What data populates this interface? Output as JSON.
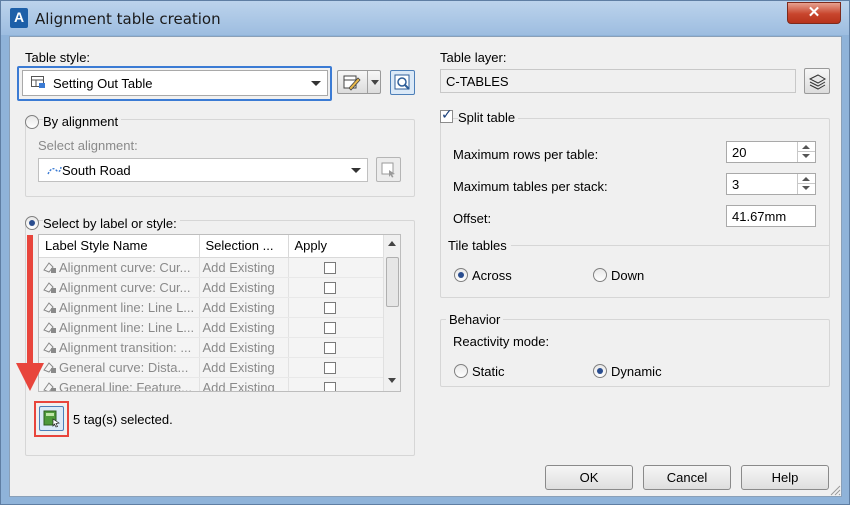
{
  "window": {
    "title": "Alignment table creation",
    "close_glyph": "✕",
    "app_icon_letter": "A"
  },
  "table_style": {
    "label": "Table style:",
    "selected": "Setting Out Table"
  },
  "by_alignment": {
    "label": "By alignment",
    "select_label": "Select alignment:",
    "selected": "South Road",
    "checked": false
  },
  "select_by_label": {
    "label": "Select by label or style:",
    "checked": true,
    "columns": [
      "Label Style Name",
      "Selection ...",
      "Apply"
    ],
    "rows": [
      {
        "name": "Alignment curve: Cur...",
        "selection": "Add Existing",
        "apply": false
      },
      {
        "name": "Alignment curve: Cur...",
        "selection": "Add Existing",
        "apply": false
      },
      {
        "name": "Alignment line: Line L...",
        "selection": "Add Existing",
        "apply": false
      },
      {
        "name": "Alignment line: Line L...",
        "selection": "Add Existing",
        "apply": false
      },
      {
        "name": "Alignment transition: ...",
        "selection": "Add Existing",
        "apply": false
      },
      {
        "name": "General curve: Dista...",
        "selection": "Add Existing",
        "apply": false
      },
      {
        "name": "General line: Feature...",
        "selection": "Add Existing",
        "apply": false
      }
    ],
    "status": "5 tag(s) selected."
  },
  "table_layer": {
    "label": "Table layer:",
    "value": "C-TABLES"
  },
  "split_table": {
    "label": "Split table",
    "checked": true,
    "max_rows_label": "Maximum rows per table:",
    "max_rows": "20",
    "max_tables_label": "Maximum tables per stack:",
    "max_tables": "3",
    "offset_label": "Offset:",
    "offset": "41.67mm",
    "tile_label": "Tile tables",
    "across_label": "Across",
    "down_label": "Down",
    "tile_selected": "Across"
  },
  "behavior": {
    "label": "Behavior",
    "reactivity_label": "Reactivity mode:",
    "static_label": "Static",
    "dynamic_label": "Dynamic",
    "selected": "Dynamic"
  },
  "buttons": {
    "ok": "OK",
    "cancel": "Cancel",
    "help": "Help"
  },
  "colors": {
    "highlight_blue": "#3b7bd4",
    "annotation_red": "#e8453c",
    "title_bar": "#a9c6e6"
  },
  "icons": {
    "annotation_arrow": "down-arrow-annotation",
    "pick_button": "pick-from-drawing-icon"
  }
}
